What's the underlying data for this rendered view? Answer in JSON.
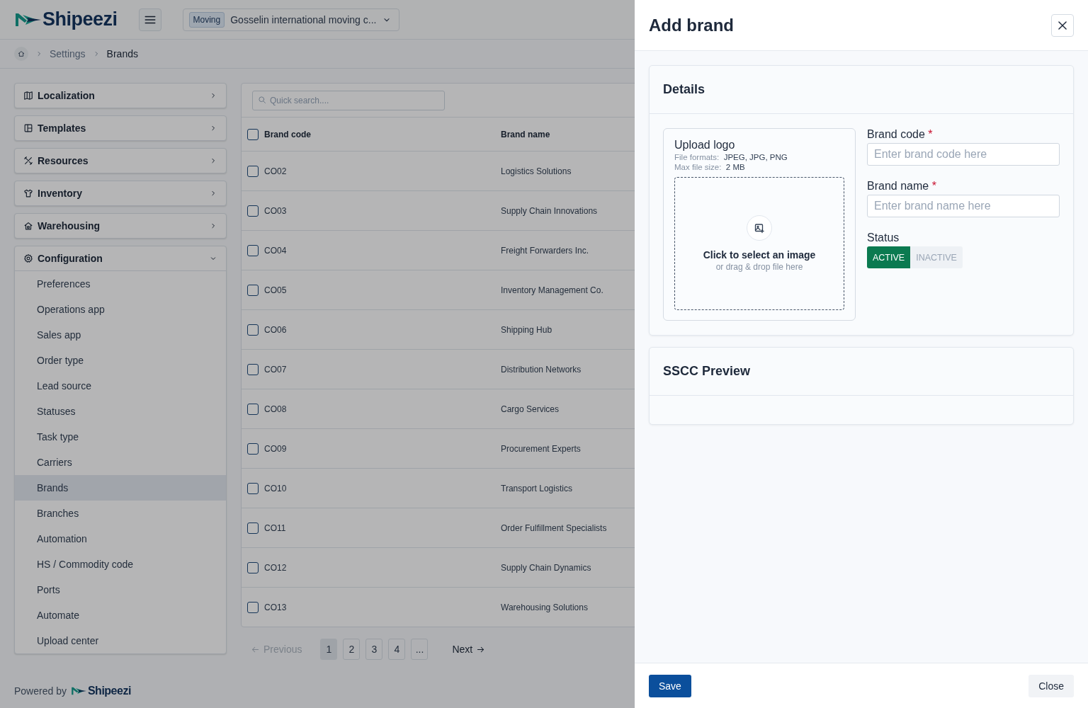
{
  "header": {
    "logo": "Shipeezi",
    "company": {
      "badge": "Moving",
      "name": "Gosselin international moving c..."
    }
  },
  "breadcrumb": [
    "Settings",
    "Brands"
  ],
  "sidebar": {
    "sections": [
      {
        "label": "Localization",
        "kind": "map",
        "expanded": false
      },
      {
        "label": "Templates",
        "kind": "layout",
        "expanded": false
      },
      {
        "label": "Resources",
        "kind": "tools",
        "expanded": false
      },
      {
        "label": "Inventory",
        "kind": "shirt",
        "expanded": false
      },
      {
        "label": "Warehousing",
        "kind": "house",
        "expanded": false
      },
      {
        "label": "Configuration",
        "kind": "gear",
        "expanded": true,
        "children": [
          {
            "label": "Preferences",
            "selected": false
          },
          {
            "label": "Operations app",
            "selected": false
          },
          {
            "label": "Sales app",
            "selected": false
          },
          {
            "label": "Order type",
            "selected": false
          },
          {
            "label": "Lead source",
            "selected": false
          },
          {
            "label": "Statuses",
            "selected": false
          },
          {
            "label": "Task type",
            "selected": false
          },
          {
            "label": "Carriers",
            "selected": false
          },
          {
            "label": "Brands",
            "selected": true
          },
          {
            "label": "Branches",
            "selected": false
          },
          {
            "label": "Automation",
            "selected": false
          },
          {
            "label": "HS / Commodity code",
            "selected": false
          },
          {
            "label": "Ports",
            "selected": false
          },
          {
            "label": "Automate",
            "selected": false
          },
          {
            "label": "Upload center",
            "selected": false
          }
        ]
      }
    ]
  },
  "table": {
    "search": {
      "placeholder": "Quick search...."
    },
    "all_checked": false,
    "columns": [
      "Brand code",
      "Brand name"
    ],
    "rows": [
      {
        "code": "CO02",
        "name": "Logistics Solutions",
        "checked": false
      },
      {
        "code": "CO03",
        "name": "Supply Chain Innovations",
        "checked": false
      },
      {
        "code": "CO04",
        "name": "Freight Forwarders Inc.",
        "checked": false
      },
      {
        "code": "CO05",
        "name": "Inventory Management Co.",
        "checked": false
      },
      {
        "code": "CO06",
        "name": "Shipping Hub",
        "checked": false
      },
      {
        "code": "CO07",
        "name": "Distribution Networks",
        "checked": false
      },
      {
        "code": "CO08",
        "name": "Cargo Services",
        "checked": false
      },
      {
        "code": "CO09",
        "name": "Procurement Experts",
        "checked": false
      },
      {
        "code": "CO10",
        "name": "Transport Logistics",
        "checked": false
      },
      {
        "code": "CO11",
        "name": "Order Fulfillment Specialists",
        "checked": false
      },
      {
        "code": "CO12",
        "name": "Supply Chain Dynamics",
        "checked": false
      },
      {
        "code": "CO13",
        "name": "Warehousing Solutions",
        "checked": false
      }
    ]
  },
  "pagination": {
    "previous": {
      "label": "Previous",
      "disabled": true
    },
    "pages": [
      {
        "label": "1",
        "selected": true
      },
      {
        "label": "2",
        "selected": false
      },
      {
        "label": "3",
        "selected": false
      },
      {
        "label": "4",
        "selected": false
      },
      {
        "label": "...",
        "selected": false
      }
    ],
    "next": {
      "label": "Next",
      "disabled": false
    }
  },
  "footer": {
    "text": "Powered by",
    "logo": "Shipeezi"
  },
  "drawer": {
    "title": "Add brand",
    "details": {
      "title": "Details",
      "upload": {
        "title": "Upload logo",
        "formats_label": "File formats:",
        "formats": "JPEG, JPG, PNG",
        "size_label": "Max file size:",
        "size": "2 MB",
        "drop_title": "Click to select an image",
        "drop_hint": "or drag & drop file here"
      },
      "fields": [
        {
          "label": "Brand code",
          "required_mark": "*",
          "placeholder": "Enter brand code here"
        },
        {
          "label": "Brand name",
          "required_mark": "*",
          "placeholder": "Enter brand name here"
        }
      ],
      "status": {
        "label": "Status",
        "options": [
          {
            "label": "ACTIVE",
            "selected": true
          },
          {
            "label": "INACTIVE",
            "selected": false
          }
        ]
      }
    },
    "sscc": {
      "title": "SSCC Preview"
    },
    "buttons": {
      "save": "Save",
      "close": "Close"
    }
  }
}
